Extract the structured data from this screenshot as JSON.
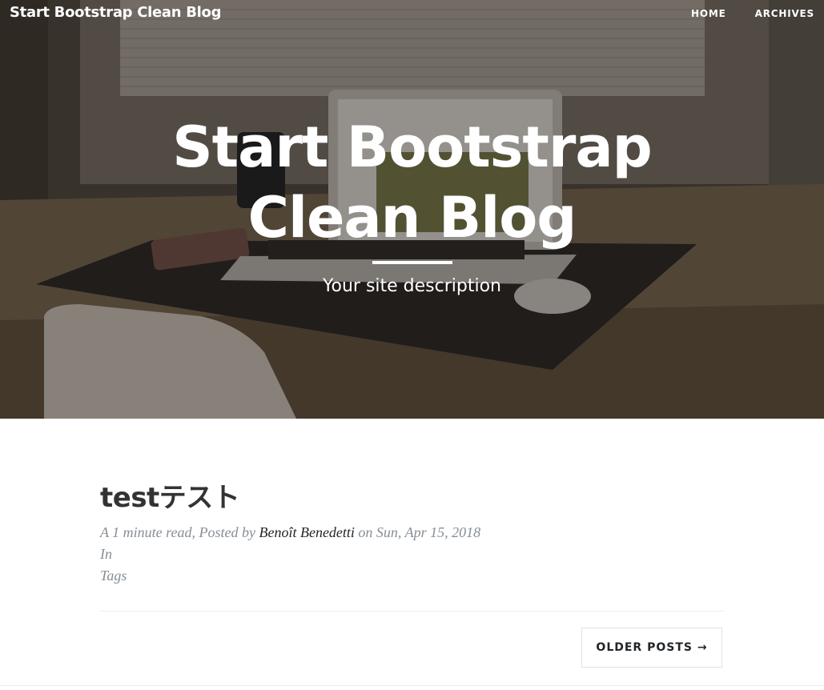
{
  "nav": {
    "brand": "Start Bootstrap Clean Blog",
    "links": [
      {
        "label": "HOME"
      },
      {
        "label": "ARCHIVES"
      }
    ]
  },
  "header": {
    "title": "Start Bootstrap Clean Blog",
    "subheading": "Your site description"
  },
  "post": {
    "title": "testテスト",
    "meta_prefix": "A 1 minute read, Posted by ",
    "author": "Benoît Benedetti",
    "meta_date": " on Sun, Apr 15, 2018",
    "category_label": "In",
    "tags_label": "Tags"
  },
  "pager": {
    "older_label": "OLDER POSTS →"
  },
  "colors": {
    "text_dark": "#212529",
    "text_muted": "#868e96",
    "title": "#333333",
    "border": "#dee2e6"
  }
}
